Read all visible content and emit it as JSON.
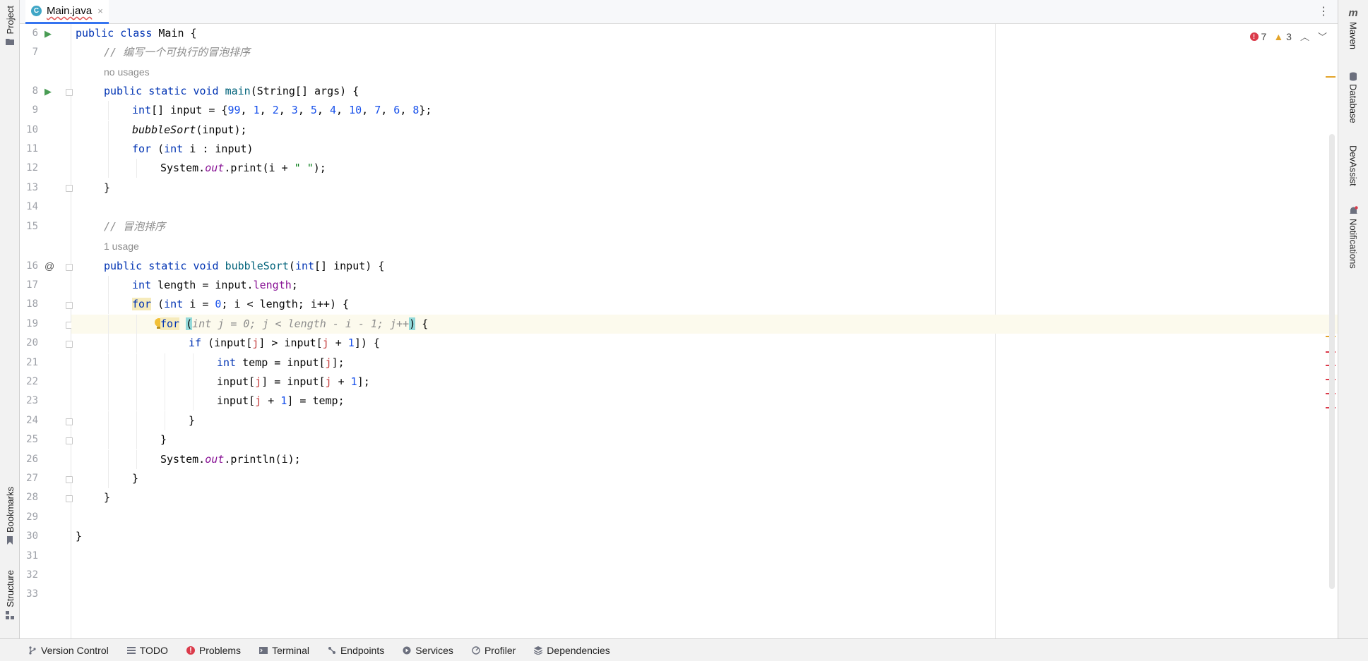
{
  "tab": {
    "file_name": "Main.java",
    "file_icon": "C",
    "close": "×"
  },
  "left_tools": [
    {
      "label": "Project",
      "icon": "folder-icon"
    },
    {
      "label": "Bookmarks",
      "icon": "bookmark-icon"
    },
    {
      "label": "Structure",
      "icon": "structure-icon"
    }
  ],
  "right_tools": [
    {
      "label": "Maven",
      "icon": "maven-icon",
      "icon_text": "m"
    },
    {
      "label": "Database",
      "icon": "database-icon"
    },
    {
      "label": "DevAssist",
      "icon": ""
    },
    {
      "label": "Notifications",
      "icon": "bell-icon"
    }
  ],
  "inspections": {
    "errors": "7",
    "warnings": "3"
  },
  "gutter_lines": [
    "6",
    "7",
    "",
    "8",
    "9",
    "10",
    "11",
    "12",
    "13",
    "14",
    "15",
    "",
    "16",
    "17",
    "18",
    "19",
    "20",
    "21",
    "22",
    "23",
    "24",
    "25",
    "26",
    "27",
    "28",
    "29",
    "30",
    "31",
    "32",
    "33"
  ],
  "code": {
    "l6": [
      "public",
      " ",
      "class",
      " Main {"
    ],
    "l7": "// 编写一个可执行的冒泡排序",
    "hint1": "no usages",
    "l8": [
      "public",
      " ",
      "static",
      " ",
      "void",
      " ",
      "main",
      "(String[] args) {"
    ],
    "l9": [
      "int",
      "[] input = {",
      "99",
      ", ",
      "1",
      ", ",
      "2",
      ", ",
      "3",
      ", ",
      "5",
      ", ",
      "4",
      ", ",
      "10",
      ", ",
      "7",
      ", ",
      "6",
      ", ",
      "8",
      "};"
    ],
    "l10": [
      "bubbleSort",
      "(input);"
    ],
    "l11": [
      "for",
      " (",
      "int",
      " i : input)"
    ],
    "l12": [
      "System.",
      "out",
      ".print(i + ",
      "\" \"",
      ");"
    ],
    "l13": "}",
    "l15": "// 冒泡排序",
    "hint2": "1 usage",
    "l16": [
      "public",
      " ",
      "static",
      " ",
      "void",
      " ",
      "bubbleSort",
      "(",
      "int",
      "[] input) {"
    ],
    "l17": [
      "int",
      " length = input.",
      "length",
      ";"
    ],
    "l18": [
      "for",
      " (",
      "int",
      " i = ",
      "0",
      "; i < length; i++) {"
    ],
    "l19": [
      "for",
      " ",
      "(",
      "int j = 0; j < length - i - 1; j++",
      ")",
      " {"
    ],
    "l20": [
      "if",
      " (input[",
      "j",
      "] > input[",
      "j",
      " + ",
      "1",
      "]) {"
    ],
    "l21": [
      "int",
      " temp = input[",
      "j",
      "];"
    ],
    "l22": [
      "input[",
      "j",
      "] = input[",
      "j",
      " + ",
      "1",
      "];"
    ],
    "l23": [
      "input[",
      "j",
      " + ",
      "1",
      "] = temp;"
    ],
    "l24": "}",
    "l25": "}",
    "l26": [
      "System.",
      "out",
      ".println(i);"
    ],
    "l27": "}",
    "l28": "}",
    "l30": "}"
  },
  "status_bar": [
    {
      "label": "Version Control",
      "icon": "git-branch-icon"
    },
    {
      "label": "TODO",
      "icon": "list-icon"
    },
    {
      "label": "Problems",
      "icon": "error-icon"
    },
    {
      "label": "Terminal",
      "icon": "terminal-icon"
    },
    {
      "label": "Endpoints",
      "icon": "endpoints-icon"
    },
    {
      "label": "Services",
      "icon": "services-icon"
    },
    {
      "label": "Profiler",
      "icon": "profiler-icon"
    },
    {
      "label": "Dependencies",
      "icon": "dependencies-icon"
    }
  ],
  "colors": {
    "keyword": "#0033b3",
    "number": "#1750eb",
    "string": "#067d17",
    "comment": "#8c8c8c",
    "method": "#00627a",
    "field": "#871094",
    "error": "#db3b4b",
    "warning": "#e3a42a",
    "tab_accent": "#3574f0"
  }
}
